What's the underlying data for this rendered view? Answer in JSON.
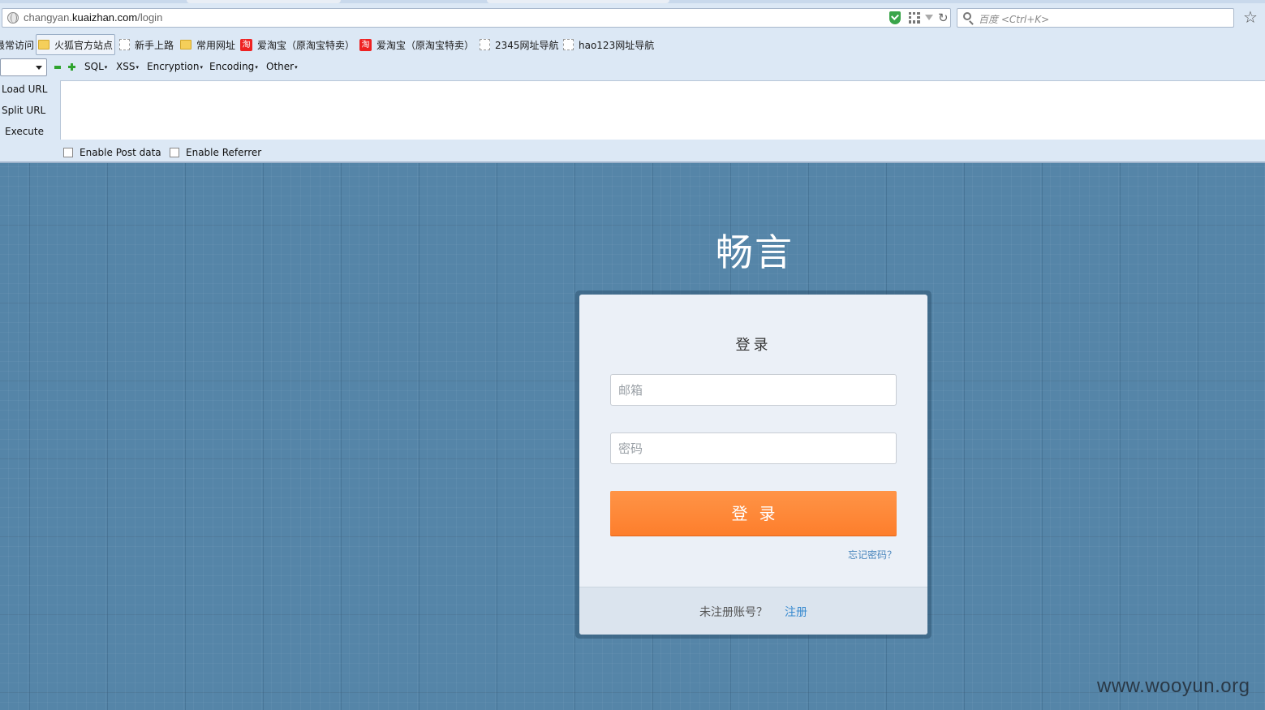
{
  "browser": {
    "url": {
      "prefix": "changyan.",
      "host": "kuaizhan.com",
      "path": "/login"
    },
    "search_placeholder": "百度 <Ctrl+K>",
    "bookmarks": [
      {
        "label": "最常访问",
        "icon": "page-icon"
      },
      {
        "label": "火狐官方站点",
        "icon": "folder-icon",
        "active": true
      },
      {
        "label": "新手上路",
        "icon": "page-icon"
      },
      {
        "label": "常用网址",
        "icon": "folder-icon"
      },
      {
        "label": "爱淘宝（原淘宝特卖）",
        "icon": "taobao-icon"
      },
      {
        "label": "爱淘宝（原淘宝特卖）",
        "icon": "taobao-icon"
      },
      {
        "label": "2345网址导航",
        "icon": "page-icon"
      },
      {
        "label": "hao123网址导航",
        "icon": "page-icon"
      }
    ],
    "taobao_glyph": "淘"
  },
  "hackbar": {
    "menus": [
      "SQL",
      "XSS",
      "Encryption",
      "Encoding",
      "Other"
    ],
    "commands": [
      "Load URL",
      "Split URL",
      "Execute"
    ],
    "options": [
      "Enable Post data",
      "Enable Referrer"
    ]
  },
  "page": {
    "logo": "畅言",
    "title": "登录",
    "email_placeholder": "邮箱",
    "password_placeholder": "密码",
    "login_button": "登录",
    "forgot_link": "忘记密码？",
    "footer_text": "未注册账号？",
    "register_link": "注册",
    "watermark": "www.wooyun.org"
  },
  "colors": {
    "page_bg": "#5585a8",
    "login_button": "#fd8a3a",
    "link": "#3a8bd0"
  }
}
